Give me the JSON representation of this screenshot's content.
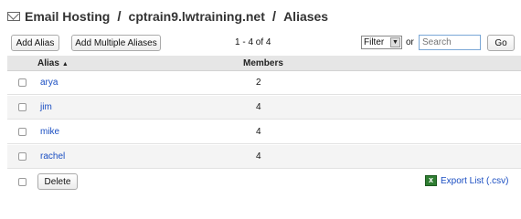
{
  "breadcrumb": {
    "items": [
      "Email Hosting",
      "cptrain9.lwtraining.net",
      "Aliases"
    ],
    "separator": "/"
  },
  "toolbar": {
    "add_alias_label": "Add Alias",
    "add_multiple_label": "Add Multiple Aliases",
    "range_text": "1 - 4 of 4",
    "filter_value": "Filter",
    "or_label": "or",
    "search_placeholder": "Search",
    "go_label": "Go"
  },
  "table": {
    "columns": {
      "alias": "Alias",
      "members": "Members"
    },
    "sort_indicator": "▲",
    "rows": [
      {
        "alias": "arya",
        "members": "2"
      },
      {
        "alias": "jim",
        "members": "4"
      },
      {
        "alias": "mike",
        "members": "4"
      },
      {
        "alias": "rachel",
        "members": "4"
      }
    ]
  },
  "footer": {
    "delete_label": "Delete",
    "export_label": "Export List (.csv)"
  },
  "colors": {
    "link": "#1a4ec2",
    "header_bg": "#e6e6e6",
    "alt_row_bg": "#f4f4f4",
    "excel_green": "#2f7d32"
  }
}
